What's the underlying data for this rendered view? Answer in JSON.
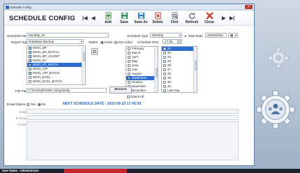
{
  "window": {
    "title": "Schedule Config",
    "close_glyph": "✕"
  },
  "toolbar": {
    "heading": "SCHEDULE CONFIG",
    "first_glyph": "|◀",
    "prev_glyph": "◀",
    "next_glyph": "▶",
    "last_glyph": "▶|",
    "add": "Add",
    "save": "Save",
    "save_as": "Save As",
    "delete": "Delete",
    "find": "Find",
    "refresh": "Refresh",
    "close": "Close"
  },
  "form": {
    "schedule_name_label": "Schedule Name",
    "schedule_name_value": "Monthly_01",
    "schedule_type_label": "Schedule Type",
    "schedule_type_value": "Monthly",
    "start_date_label": "Start Date",
    "start_date_value": "22/09/2022",
    "report_type_label": "Report Type",
    "report_type_value": "Database Backup",
    "states_label": "States",
    "active_label": "Active",
    "not_active_label": "Not Active",
    "schedule_time_label": "Schedule Time",
    "schedule_time_value": "17:35",
    "reports": [
      {
        "label": "MV01_BP",
        "checked": true,
        "selected": false
      },
      {
        "label": "MV01_BP_BATCH",
        "checked": true,
        "selected": false
      },
      {
        "label": "MV01_BP_JACKET",
        "checked": true,
        "selected": false
      },
      {
        "label": "MV01_BT",
        "checked": true,
        "selected": false
      },
      {
        "label": "MV01_BT_BATCH",
        "checked": true,
        "selected": true
      },
      {
        "label": "MV01_CIP",
        "checked": false,
        "selected": false
      },
      {
        "label": "MV01_CIP_BATCH",
        "checked": true,
        "selected": false
      },
      {
        "label": "MV01_EVSL",
        "checked": false,
        "selected": false
      },
      {
        "label": "MV01_EVSL_BATCH",
        "checked": false,
        "selected": false
      }
    ],
    "months": [
      {
        "label": "February",
        "checked": false,
        "selected": false
      },
      {
        "label": "March",
        "checked": false,
        "selected": false
      },
      {
        "label": "April",
        "checked": false,
        "selected": false
      },
      {
        "label": "May",
        "checked": false,
        "selected": false
      },
      {
        "label": "June",
        "checked": false,
        "selected": false
      },
      {
        "label": "July",
        "checked": false,
        "selected": false
      },
      {
        "label": "August",
        "checked": false,
        "selected": false
      },
      {
        "label": "September",
        "checked": true,
        "selected": true
      },
      {
        "label": "October",
        "checked": false,
        "selected": false
      },
      {
        "label": "November",
        "checked": false,
        "selected": false
      },
      {
        "label": "December",
        "checked": false,
        "selected": false
      }
    ],
    "days": [
      {
        "label": "22",
        "checked": false,
        "selected": true
      },
      {
        "label": "23",
        "checked": false,
        "selected": false
      },
      {
        "label": "24",
        "checked": false,
        "selected": false
      },
      {
        "label": "25",
        "checked": false,
        "selected": false
      },
      {
        "label": "26",
        "checked": false,
        "selected": false
      },
      {
        "label": "27",
        "checked": false,
        "selected": false
      },
      {
        "label": "28",
        "checked": false,
        "selected": false
      },
      {
        "label": "29",
        "checked": false,
        "selected": false
      },
      {
        "label": "30",
        "checked": false,
        "selected": false
      },
      {
        "label": "31",
        "checked": false,
        "selected": false
      },
      {
        "label": "Last Day",
        "checked": false,
        "selected": false
      }
    ],
    "check_all_label": "Check All",
    "file_path_label": "File Path",
    "file_path_value": "F:\\Rushabh\\SRK Setup\\Daily",
    "browse_label": "Browse",
    "email_option_label": "Email Option",
    "yes_label": "Yes",
    "no_label": "No",
    "next_schedule": "NEXT SCHEDULE DATE  -  2022-09-23  17:45:00",
    "subject_label": "Subject",
    "to_email_label": "To Email",
    "content_label": "Content"
  },
  "status": {
    "user": "User Name : Administrator"
  },
  "colors": {
    "accent": "#2f6cd0",
    "selection": "#2f6cd0",
    "next_schedule": "#2a6ad0",
    "close_red": "#d43b2f",
    "status_bar": "#1d2233"
  }
}
